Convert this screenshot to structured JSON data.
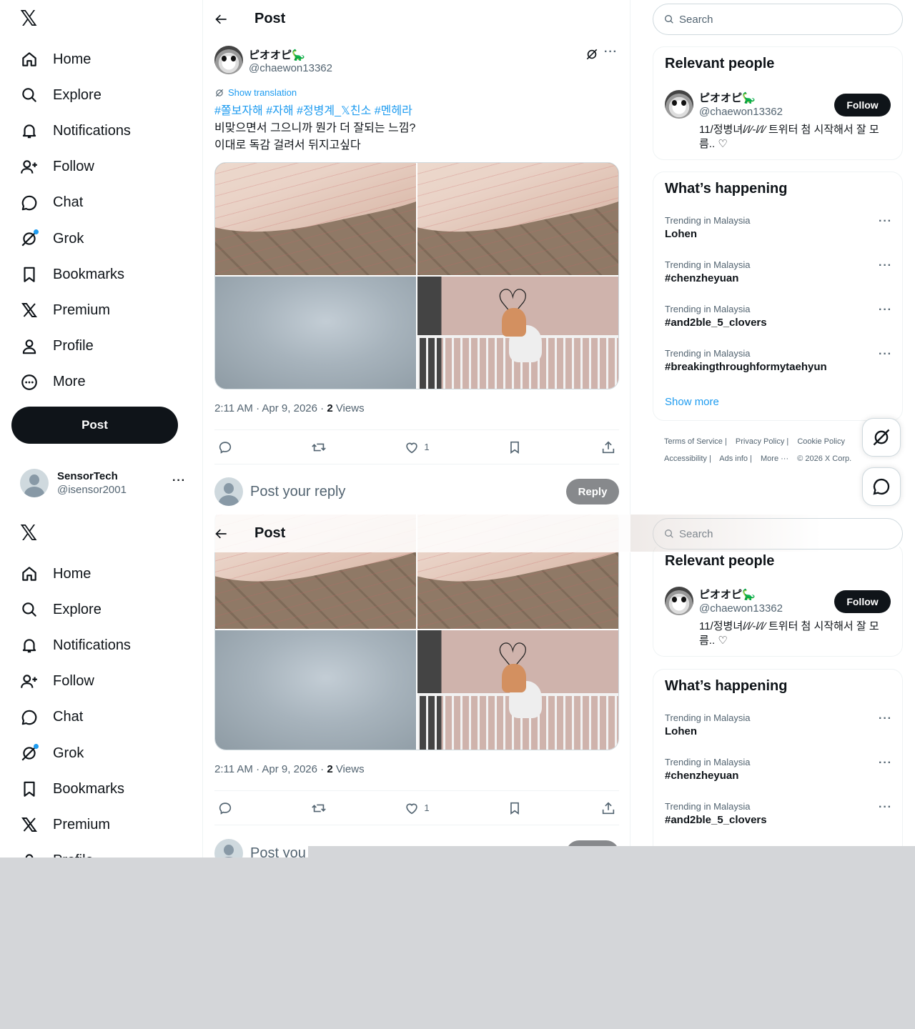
{
  "sidebar": {
    "logo": "𝕏",
    "items": [
      {
        "label": "Home",
        "icon": "home-icon"
      },
      {
        "label": "Explore",
        "icon": "search-icon"
      },
      {
        "label": "Notifications",
        "icon": "bell-icon"
      },
      {
        "label": "Follow",
        "icon": "person-add-icon"
      },
      {
        "label": "Chat",
        "icon": "chat-icon"
      },
      {
        "label": "Grok",
        "icon": "grok-icon"
      },
      {
        "label": "Bookmarks",
        "icon": "bookmark-icon"
      },
      {
        "label": "Premium",
        "icon": "x-logo-icon"
      },
      {
        "label": "Profile",
        "icon": "person-icon"
      },
      {
        "label": "More",
        "icon": "more-circle-icon"
      }
    ],
    "post_button": "Post",
    "account": {
      "name": "SensorTech",
      "handle": "@isensor2001",
      "more": "···"
    }
  },
  "main": {
    "title": "Post",
    "tweet": {
      "name": "ピオオピ🦕",
      "handle": "@chaewon13362",
      "more": "···",
      "show_translation": "Show translation",
      "hashtags": "#쫄보자해 #자해 #정병계_𝕏친소 #멘헤라",
      "line1": "비맞으면서 그으니까 뭔가 더 잘되는 느낌?",
      "line2": "이대로 독감 걸려서 뒤지고싶다",
      "time": "2:11 AM · Apr 9, 2026 · ",
      "views_count": "2",
      "views_label": " Views",
      "likes": "1",
      "heart_glyph": "♡"
    },
    "reply": {
      "placeholder": "Post your reply",
      "partial_placeholder": "Post you",
      "button": "Reply"
    }
  },
  "right": {
    "search_placeholder": "Search",
    "relevant": {
      "title": "Relevant people",
      "name": "ピオオピ🦕",
      "handle": "@chaewon13362",
      "follow": "Follow",
      "bio": "11/정병녀/⁄/⁄-/⁄/⁄ 트위터 첨 시작해서 잘 모름..  ♡"
    },
    "happening": {
      "title": "What’s happening",
      "trends": [
        {
          "context": "Trending in Malaysia",
          "name": "Lohen"
        },
        {
          "context": "Trending in Malaysia",
          "name": "#chenzheyuan"
        },
        {
          "context": "Trending in Malaysia",
          "name": "#and2ble_5_clovers"
        },
        {
          "context": "Trending in Malaysia",
          "name": "#breakingthroughformytaehyun"
        }
      ],
      "show_more": "Show more",
      "more": "···"
    },
    "footer": [
      "Terms of Service  |",
      "Privacy Policy  |",
      "Cookie Policy",
      "Accessibility  |",
      "Ads info  |",
      "More ···",
      "© 2026 X Corp."
    ]
  },
  "colors": {
    "accent": "#1d9bf0",
    "text": "#0f1419",
    "muted": "#536471",
    "reply_button": "#87898c"
  }
}
